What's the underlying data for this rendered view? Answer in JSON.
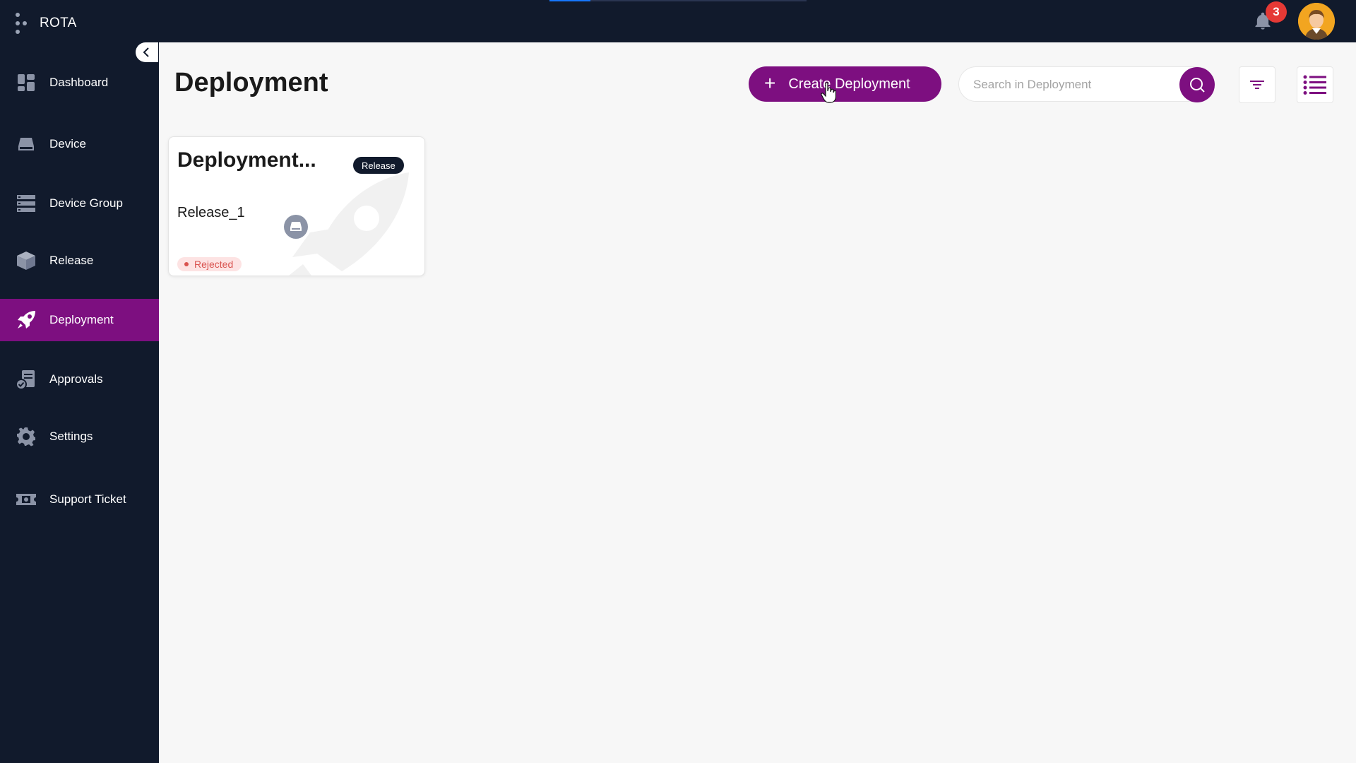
{
  "app": {
    "name": "ROTA"
  },
  "notifications": {
    "count": "3"
  },
  "loading": {
    "progress": 0.16
  },
  "sidebar": {
    "items": [
      {
        "label": "Dashboard",
        "icon": "dashboard-icon"
      },
      {
        "label": "Device",
        "icon": "device-icon"
      },
      {
        "label": "Device Group",
        "icon": "device-group-icon"
      },
      {
        "label": "Release",
        "icon": "release-box-icon"
      },
      {
        "label": "Deployment",
        "icon": "rocket-icon",
        "active": true
      },
      {
        "label": "Approvals",
        "icon": "approvals-icon"
      },
      {
        "label": "Settings",
        "icon": "gear-icon"
      },
      {
        "label": "Support Ticket",
        "icon": "ticket-icon"
      }
    ]
  },
  "main": {
    "title": "Deployment",
    "create_label": "Create Deployment",
    "search": {
      "placeholder": "Search in Deployment",
      "value": ""
    }
  },
  "cards": [
    {
      "title": "Deployment...",
      "tag": "Release",
      "subtitle": "Release_1",
      "status": "Rejected"
    }
  ],
  "colors": {
    "accent": "#7d0f80",
    "sidebar_bg": "#111a2c",
    "status_rejected": "#d9534f",
    "badge": "#e53935"
  }
}
